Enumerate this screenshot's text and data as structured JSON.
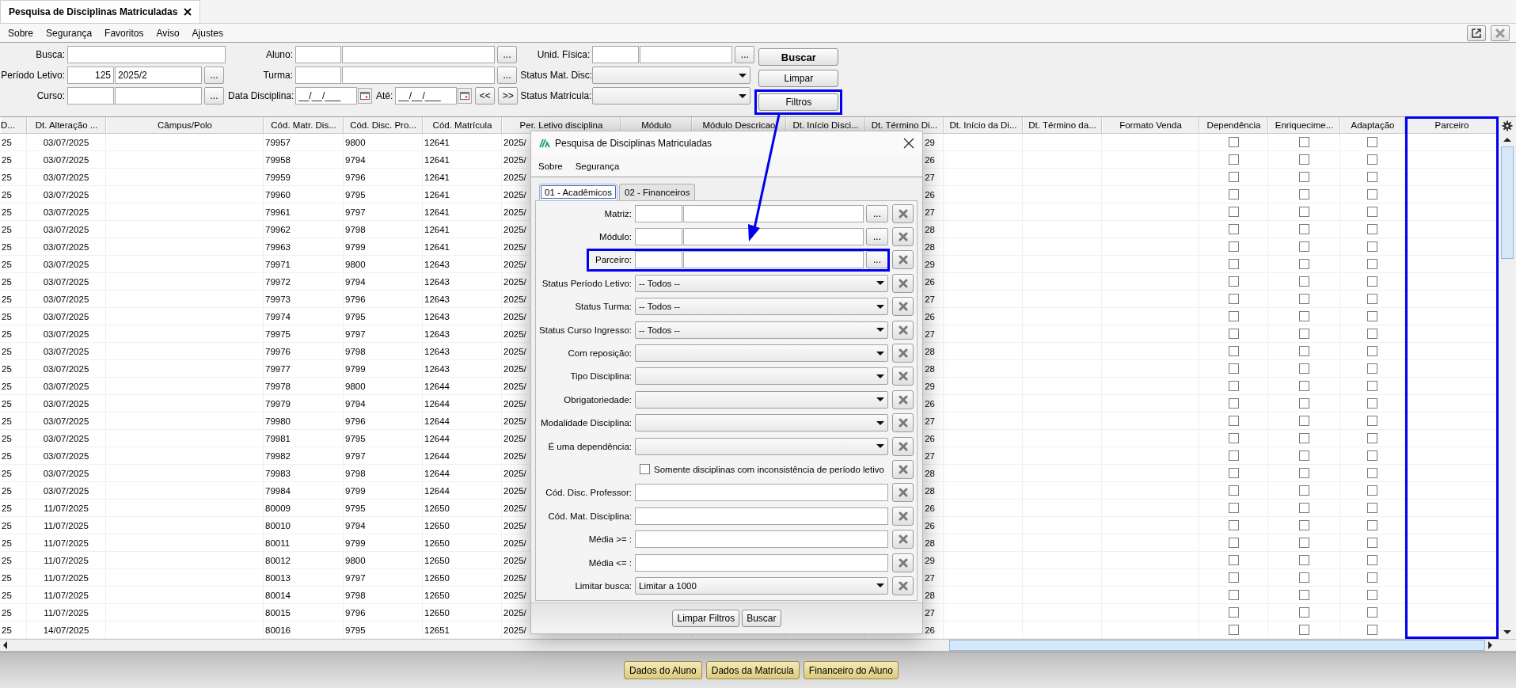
{
  "tab": {
    "title": "Pesquisa de Disciplinas Matriculadas",
    "selected": true
  },
  "menu": [
    "Sobre",
    "Segurança",
    "Favoritos",
    "Aviso",
    "Ajustes"
  ],
  "form": {
    "groups": [
      {
        "fields": [
          {
            "kind": "text",
            "label": "Busca:"
          },
          {
            "kind": "lookup",
            "label": "Período Letivo:",
            "code": "125",
            "name": "2025/2",
            "button": "..."
          },
          {
            "kind": "lookup",
            "label": "Curso:",
            "button": "..."
          }
        ]
      },
      {
        "fields": [
          {
            "kind": "lookup",
            "label": "Aluno:",
            "button": "..."
          },
          {
            "kind": "lookup",
            "label": "Turma:",
            "button": "..."
          },
          {
            "kind": "date_range",
            "label": "Data Disciplina:",
            "from": "__/__/___",
            "to_label": "Até:",
            "to": "__/__/___",
            "prev": "<<",
            "next": ">>"
          }
        ]
      },
      {
        "fields": [
          {
            "kind": "lookup",
            "label": "Unid. Física:",
            "button": "..."
          },
          {
            "kind": "select",
            "label": "Status Mat. Disc:"
          },
          {
            "kind": "select",
            "label": "Status Matrícula:"
          }
        ]
      }
    ],
    "buttons": [
      {
        "label": "Buscar",
        "kind": "primary",
        "highlighted": false
      },
      {
        "label": "Limpar",
        "kind": "normal",
        "highlighted": false
      },
      {
        "label": "Filtros",
        "kind": "normal",
        "highlighted": true
      }
    ]
  },
  "table": {
    "columns": [
      {
        "label": "D...",
        "highlighted": false
      },
      {
        "label": "Dt. Alteração ...",
        "highlighted": false
      },
      {
        "label": "Câmpus/Polo",
        "highlighted": false
      },
      {
        "label": "Cód. Matr. Dis...",
        "highlighted": false
      },
      {
        "label": "Cód. Disc. Pro...",
        "highlighted": false
      },
      {
        "label": "Cód. Matrícula",
        "highlighted": false
      },
      {
        "label": "Per. Letivo disciplina",
        "highlighted": false
      },
      {
        "label": "Módulo",
        "highlighted": false
      },
      {
        "label": "Módulo Descricao",
        "highlighted": false
      },
      {
        "label": "Dt. Início Disci...",
        "highlighted": false
      },
      {
        "label": "Dt. Término Di...",
        "highlighted": false
      },
      {
        "label": "Dt. Início da Di...",
        "highlighted": false
      },
      {
        "label": "Dt. Término da...",
        "highlighted": false
      },
      {
        "label": "Formato Venda",
        "highlighted": false
      },
      {
        "label": "Dependência",
        "highlighted": false
      },
      {
        "label": "Enriquecime...",
        "highlighted": false
      },
      {
        "label": "Adaptação",
        "highlighted": false
      },
      {
        "label": "Parceiro",
        "highlighted": true
      }
    ],
    "rows": [
      [
        "25",
        "03/07/2025",
        null,
        "79957",
        "9800",
        "12641",
        "2025/",
        null,
        null,
        null,
        "29",
        null,
        null,
        null,
        {
          "checked": false
        },
        {
          "checked": false
        },
        {
          "checked": false
        },
        null
      ],
      [
        "25",
        "03/07/2025",
        null,
        "79958",
        "9794",
        "12641",
        "2025/",
        null,
        null,
        null,
        "26",
        null,
        null,
        null,
        {
          "checked": false
        },
        {
          "checked": false
        },
        {
          "checked": false
        },
        null
      ],
      [
        "25",
        "03/07/2025",
        null,
        "79959",
        "9796",
        "12641",
        "2025/",
        null,
        null,
        null,
        "27",
        null,
        null,
        null,
        {
          "checked": false
        },
        {
          "checked": false
        },
        {
          "checked": false
        },
        null
      ],
      [
        "25",
        "03/07/2025",
        null,
        "79960",
        "9795",
        "12641",
        "2025/",
        null,
        null,
        null,
        "26",
        null,
        null,
        null,
        {
          "checked": false
        },
        {
          "checked": false
        },
        {
          "checked": false
        },
        null
      ],
      [
        "25",
        "03/07/2025",
        null,
        "79961",
        "9797",
        "12641",
        "2025/",
        null,
        null,
        null,
        "27",
        null,
        null,
        null,
        {
          "checked": false
        },
        {
          "checked": false
        },
        {
          "checked": false
        },
        null
      ],
      [
        "25",
        "03/07/2025",
        null,
        "79962",
        "9798",
        "12641",
        "2025/",
        null,
        null,
        null,
        "28",
        null,
        null,
        null,
        {
          "checked": false
        },
        {
          "checked": false
        },
        {
          "checked": false
        },
        null
      ],
      [
        "25",
        "03/07/2025",
        null,
        "79963",
        "9799",
        "12641",
        "2025/",
        null,
        null,
        null,
        "28",
        null,
        null,
        null,
        {
          "checked": false
        },
        {
          "checked": false
        },
        {
          "checked": false
        },
        null
      ],
      [
        "25",
        "03/07/2025",
        null,
        "79971",
        "9800",
        "12643",
        "2025/",
        null,
        null,
        null,
        "29",
        null,
        null,
        null,
        {
          "checked": false
        },
        {
          "checked": false
        },
        {
          "checked": false
        },
        null
      ],
      [
        "25",
        "03/07/2025",
        null,
        "79972",
        "9794",
        "12643",
        "2025/",
        null,
        null,
        null,
        "26",
        null,
        null,
        null,
        {
          "checked": false
        },
        {
          "checked": false
        },
        {
          "checked": false
        },
        null
      ],
      [
        "25",
        "03/07/2025",
        null,
        "79973",
        "9796",
        "12643",
        "2025/",
        null,
        null,
        null,
        "27",
        null,
        null,
        null,
        {
          "checked": false
        },
        {
          "checked": false
        },
        {
          "checked": false
        },
        null
      ],
      [
        "25",
        "03/07/2025",
        null,
        "79974",
        "9795",
        "12643",
        "2025/",
        null,
        null,
        null,
        "26",
        null,
        null,
        null,
        {
          "checked": false
        },
        {
          "checked": false
        },
        {
          "checked": false
        },
        null
      ],
      [
        "25",
        "03/07/2025",
        null,
        "79975",
        "9797",
        "12643",
        "2025/",
        null,
        null,
        null,
        "27",
        null,
        null,
        null,
        {
          "checked": false
        },
        {
          "checked": false
        },
        {
          "checked": false
        },
        null
      ],
      [
        "25",
        "03/07/2025",
        null,
        "79976",
        "9798",
        "12643",
        "2025/",
        null,
        null,
        null,
        "28",
        null,
        null,
        null,
        {
          "checked": false
        },
        {
          "checked": false
        },
        {
          "checked": false
        },
        null
      ],
      [
        "25",
        "03/07/2025",
        null,
        "79977",
        "9799",
        "12643",
        "2025/",
        null,
        null,
        null,
        "28",
        null,
        null,
        null,
        {
          "checked": false
        },
        {
          "checked": false
        },
        {
          "checked": false
        },
        null
      ],
      [
        "25",
        "03/07/2025",
        null,
        "79978",
        "9800",
        "12644",
        "2025/",
        null,
        null,
        null,
        "29",
        null,
        null,
        null,
        {
          "checked": false
        },
        {
          "checked": false
        },
        {
          "checked": false
        },
        null
      ],
      [
        "25",
        "03/07/2025",
        null,
        "79979",
        "9794",
        "12644",
        "2025/",
        null,
        null,
        null,
        "26",
        null,
        null,
        null,
        {
          "checked": false
        },
        {
          "checked": false
        },
        {
          "checked": false
        },
        null
      ],
      [
        "25",
        "03/07/2025",
        null,
        "79980",
        "9796",
        "12644",
        "2025/",
        null,
        null,
        null,
        "27",
        null,
        null,
        null,
        {
          "checked": false
        },
        {
          "checked": false
        },
        {
          "checked": false
        },
        null
      ],
      [
        "25",
        "03/07/2025",
        null,
        "79981",
        "9795",
        "12644",
        "2025/",
        null,
        null,
        null,
        "26",
        null,
        null,
        null,
        {
          "checked": false
        },
        {
          "checked": false
        },
        {
          "checked": false
        },
        null
      ],
      [
        "25",
        "03/07/2025",
        null,
        "79982",
        "9797",
        "12644",
        "2025/",
        null,
        null,
        null,
        "27",
        null,
        null,
        null,
        {
          "checked": false
        },
        {
          "checked": false
        },
        {
          "checked": false
        },
        null
      ],
      [
        "25",
        "03/07/2025",
        null,
        "79983",
        "9798",
        "12644",
        "2025/",
        null,
        null,
        null,
        "28",
        null,
        null,
        null,
        {
          "checked": false
        },
        {
          "checked": false
        },
        {
          "checked": false
        },
        null
      ],
      [
        "25",
        "03/07/2025",
        null,
        "79984",
        "9799",
        "12644",
        "2025/",
        null,
        null,
        null,
        "28",
        null,
        null,
        null,
        {
          "checked": false
        },
        {
          "checked": false
        },
        {
          "checked": false
        },
        null
      ],
      [
        "25",
        "11/07/2025",
        null,
        "80009",
        "9795",
        "12650",
        "2025/",
        null,
        null,
        null,
        "26",
        null,
        null,
        null,
        {
          "checked": false
        },
        {
          "checked": false
        },
        {
          "checked": false
        },
        null
      ],
      [
        "25",
        "11/07/2025",
        null,
        "80010",
        "9794",
        "12650",
        "2025/",
        null,
        null,
        null,
        "26",
        null,
        null,
        null,
        {
          "checked": false
        },
        {
          "checked": false
        },
        {
          "checked": false
        },
        null
      ],
      [
        "25",
        "11/07/2025",
        null,
        "80011",
        "9799",
        "12650",
        "2025/",
        null,
        null,
        null,
        "28",
        null,
        null,
        null,
        {
          "checked": false
        },
        {
          "checked": false
        },
        {
          "checked": false
        },
        null
      ],
      [
        "25",
        "11/07/2025",
        null,
        "80012",
        "9800",
        "12650",
        "2025/",
        null,
        null,
        null,
        "29",
        null,
        null,
        null,
        {
          "checked": false
        },
        {
          "checked": false
        },
        {
          "checked": false
        },
        null
      ],
      [
        "25",
        "11/07/2025",
        null,
        "80013",
        "9797",
        "12650",
        "2025/",
        null,
        null,
        null,
        "27",
        null,
        null,
        null,
        {
          "checked": false
        },
        {
          "checked": false
        },
        {
          "checked": false
        },
        null
      ],
      [
        "25",
        "11/07/2025",
        null,
        "80014",
        "9798",
        "12650",
        "2025/",
        null,
        null,
        null,
        "28",
        null,
        null,
        null,
        {
          "checked": false
        },
        {
          "checked": false
        },
        {
          "checked": false
        },
        null
      ],
      [
        "25",
        "11/07/2025",
        null,
        "80015",
        "9796",
        "12650",
        "2025/",
        null,
        null,
        null,
        "27",
        null,
        null,
        null,
        {
          "checked": false
        },
        {
          "checked": false
        },
        {
          "checked": false
        },
        null
      ],
      [
        "25",
        "14/07/2025",
        null,
        "80016",
        "9795",
        "12651",
        "2025/",
        null,
        null,
        null,
        "26",
        null,
        null,
        null,
        {
          "checked": false
        },
        {
          "checked": false
        },
        {
          "checked": false
        },
        null
      ]
    ]
  },
  "bottom_buttons": [
    "Dados do Aluno",
    "Dados da Matrícula",
    "Financeiro do Aluno"
  ],
  "dialog": {
    "title": "Pesquisa de Disciplinas Matriculadas",
    "menu": [
      "Sobre",
      "Segurança"
    ],
    "tabs": [
      {
        "label": "01 - Acadêmicos",
        "selected": true
      },
      {
        "label": "02 - Financeiros",
        "selected": false
      }
    ],
    "fields": [
      {
        "kind": "lookup",
        "label": "Matriz:",
        "button": "...",
        "highlighted": false
      },
      {
        "kind": "lookup",
        "label": "Módulo:",
        "button": "...",
        "highlighted": false
      },
      {
        "kind": "lookup",
        "label": "Parceiro:",
        "button": "...",
        "highlighted": true
      },
      {
        "kind": "select",
        "label": "Status Período Letivo:",
        "value": "-- Todos --"
      },
      {
        "kind": "select",
        "label": "Status Turma:",
        "value": "-- Todos --"
      },
      {
        "kind": "select",
        "label": "Status Curso Ingresso:",
        "value": "-- Todos --"
      },
      {
        "kind": "select",
        "label": "Com reposição:"
      },
      {
        "kind": "select",
        "label": "Tipo Disciplina:"
      },
      {
        "kind": "select",
        "label": "Obrigatoriedade:"
      },
      {
        "kind": "select",
        "label": "Modalidade Disciplina:"
      },
      {
        "kind": "select",
        "label": "É uma dependência:"
      },
      {
        "kind": "checkbox",
        "label": "Somente disciplinas com inconsistência de período letivo",
        "checked": false
      },
      {
        "kind": "text",
        "label": "Cód. Disc. Professor:"
      },
      {
        "kind": "text",
        "label": "Cód. Mat. Disciplina:"
      },
      {
        "kind": "text",
        "label": "Média >= :"
      },
      {
        "kind": "text",
        "label": "Média <= :"
      },
      {
        "kind": "select",
        "label": "Limitar busca:",
        "value": "Limitar a 1000"
      }
    ],
    "buttons": [
      "Limpar Filtros",
      "Buscar"
    ]
  }
}
